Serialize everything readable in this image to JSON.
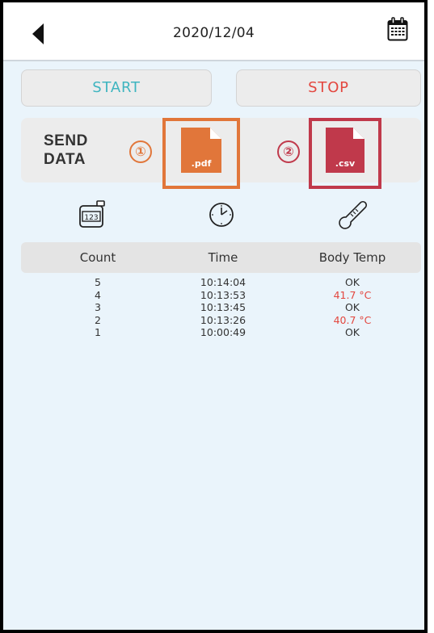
{
  "header": {
    "date": "2020/12/04"
  },
  "controls": {
    "start_label": "START",
    "stop_label": "STOP"
  },
  "send": {
    "label_line1": "SEND",
    "label_line2": "DATA",
    "pdf_number": "①",
    "pdf_ext": ".pdf",
    "csv_number": "②",
    "csv_ext": ".csv",
    "pdf_color": "#e1763a",
    "csv_color": "#c0394b"
  },
  "icons": [
    "counter-icon",
    "clock-icon",
    "thermometer-icon"
  ],
  "table": {
    "headers": [
      "Count",
      "Time",
      "Body Temp"
    ],
    "rows": [
      {
        "count": "5",
        "time": "10:14:04",
        "temp": "OK"
      },
      {
        "count": "4",
        "time": "10:13:53",
        "temp": "41.7 °C"
      },
      {
        "count": "3",
        "time": "10:13:45",
        "temp": "OK"
      },
      {
        "count": "2",
        "time": "10:13:26",
        "temp": "40.7 °C"
      },
      {
        "count": "1",
        "time": "10:00:49",
        "temp": "OK"
      }
    ]
  },
  "colors": {
    "start": "#3fb5c0",
    "stop": "#e3473f",
    "alert": "#e3473f",
    "background": "#eaf4fb"
  }
}
